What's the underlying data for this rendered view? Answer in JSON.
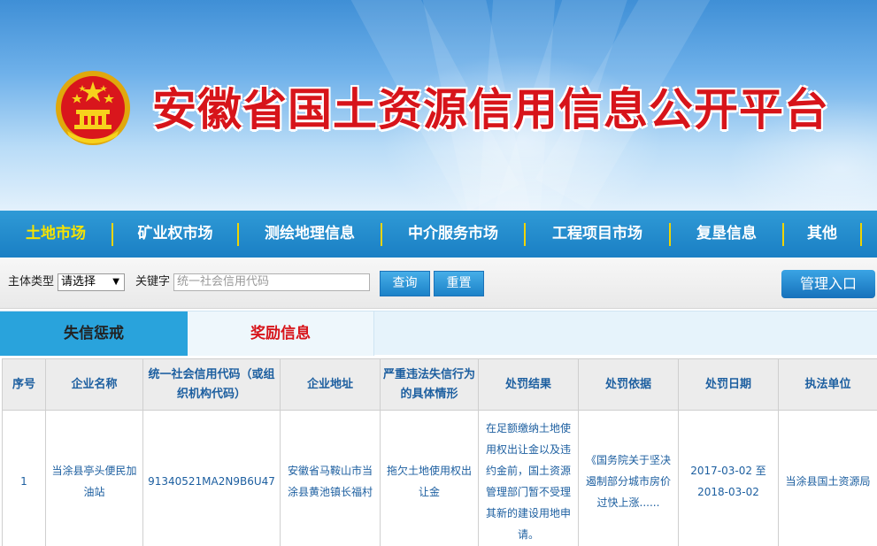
{
  "site": {
    "title": "安徽省国土资源信用信息公开平台"
  },
  "nav": {
    "items": [
      {
        "label": "土地市场",
        "active": true
      },
      {
        "label": "矿业权市场"
      },
      {
        "label": "测绘地理信息"
      },
      {
        "label": "中介服务市场"
      },
      {
        "label": "工程项目市场"
      },
      {
        "label": "复垦信息"
      },
      {
        "label": "其他"
      }
    ]
  },
  "search": {
    "subject_type_label": "主体类型",
    "subject_type_value": "请选择",
    "keyword_label": "关键字",
    "keyword_placeholder": "统一社会信用代码",
    "query_label": "查询",
    "reset_label": "重置",
    "admin_label": "管理入口"
  },
  "tabs": [
    {
      "label": "失信惩戒",
      "active": true
    },
    {
      "label": "奖励信息"
    }
  ],
  "table": {
    "headers": [
      "序号",
      "企业名称",
      "统一社会信用代码（或组织机构代码）",
      "企业地址",
      "严重违法失信行为的具体情形",
      "处罚结果",
      "处罚依据",
      "处罚日期",
      "执法单位"
    ],
    "rows": [
      [
        "1",
        "当涂县亭头便民加油站",
        "91340521MA2N9B6U47",
        "安徽省马鞍山市当涂县黄池镇长福村",
        "拖欠土地使用权出让金",
        "在足额缴纳土地使用权出让金以及违约金前，国土资源管理部门暂不受理其新的建设用地申请。",
        "《国务院关于坚决遏制部分城市房价过快上涨......",
        "2017-03-02 至 2018-03-02",
        "当涂县国土资源局"
      ]
    ]
  },
  "colors": {
    "nav_bg": "#1a7fc4",
    "nav_active": "#f7e300",
    "title_red": "#d7141a",
    "link_blue": "#1d5fa0"
  }
}
